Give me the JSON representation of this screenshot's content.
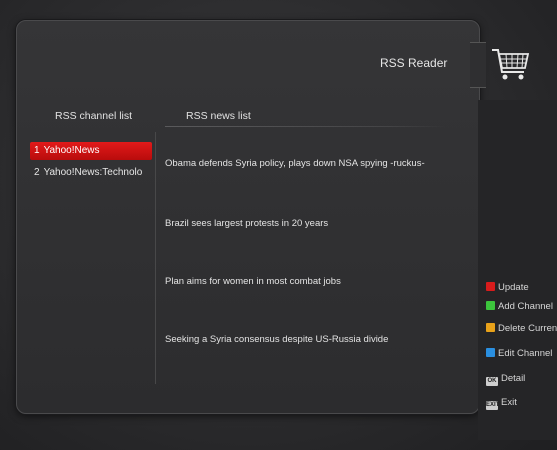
{
  "header": {
    "title": "RSS Reader",
    "cart_icon": "shopping-cart-icon"
  },
  "channels": {
    "heading": "RSS channel list",
    "items": [
      {
        "num": "1",
        "label": "Yahoo!News",
        "selected": true
      },
      {
        "num": "2",
        "label": "Yahoo!News:Technolo",
        "selected": false
      }
    ]
  },
  "news": {
    "heading": "RSS news list",
    "items": [
      "Obama defends Syria policy, plays down NSA spying -ruckus-",
      "Brazil sees largest protests in 20 years",
      "Plan aims for women in most combat jobs",
      "Seeking a Syria consensus despite US-Russia divide"
    ]
  },
  "keys": [
    {
      "label": "Update",
      "color": "#d81c1c",
      "icon": "red-key-icon"
    },
    {
      "label": "Add Channel",
      "color": "#3cc43c",
      "icon": "green-key-icon"
    },
    {
      "label": "Delete Curren",
      "color": "#e8a21a",
      "icon": "yellow-key-icon"
    },
    {
      "label": "Edit Channel",
      "color": "#2a8fe0",
      "icon": "blue-key-icon"
    },
    {
      "label": "Detail",
      "badge": "OK",
      "icon": "ok-key-icon"
    },
    {
      "label": "Exit",
      "badge": "EXIT",
      "icon": "exit-key-icon"
    }
  ]
}
